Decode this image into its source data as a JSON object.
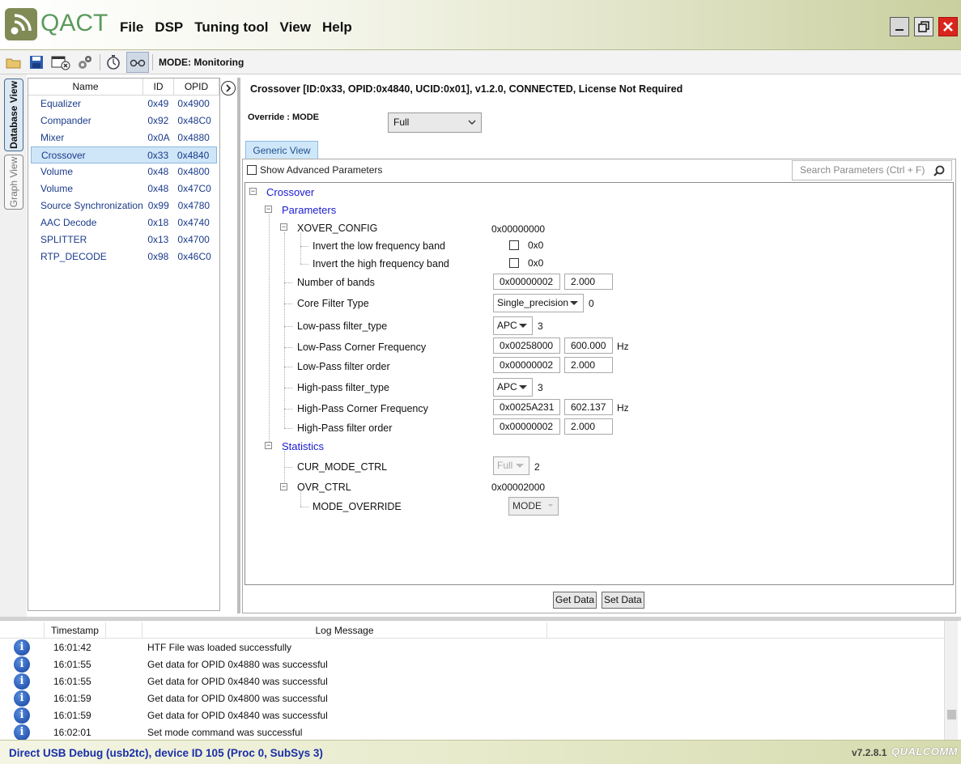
{
  "app": {
    "brand": "QACT"
  },
  "menu": [
    "File",
    "DSP",
    "Tuning tool",
    "View",
    "Help"
  ],
  "toolbar": {
    "mode": "MODE: Monitoring"
  },
  "side_tabs": {
    "database": "Database View",
    "graph": "Graph View"
  },
  "modules": {
    "headers": {
      "name": "Name",
      "id": "ID",
      "opid": "OPID"
    },
    "rows": [
      {
        "name": "Equalizer",
        "id": "0x49",
        "opid": "0x4900"
      },
      {
        "name": "Compander",
        "id": "0x92",
        "opid": "0x48C0"
      },
      {
        "name": "Mixer",
        "id": "0x0A",
        "opid": "0x4880"
      },
      {
        "name": "Crossover",
        "id": "0x33",
        "opid": "0x4840"
      },
      {
        "name": "Volume",
        "id": "0x48",
        "opid": "0x4800"
      },
      {
        "name": "Volume",
        "id": "0x48",
        "opid": "0x47C0"
      },
      {
        "name": "Source Synchronization",
        "id": "0x99",
        "opid": "0x4780"
      },
      {
        "name": "AAC Decode",
        "id": "0x18",
        "opid": "0x4740"
      },
      {
        "name": "SPLITTER",
        "id": "0x13",
        "opid": "0x4700"
      },
      {
        "name": "RTP_DECODE",
        "id": "0x98",
        "opid": "0x46C0"
      }
    ]
  },
  "detail": {
    "header": "Crossover [ID:0x33, OPID:0x4840, UCID:0x01], v1.2.0,  CONNECTED, License Not Required",
    "override_label": "Override : MODE",
    "override_value": "Full",
    "tab": "Generic View",
    "advanced_label": "Show Advanced Parameters",
    "search_placeholder": "Search Parameters (Ctrl + F)"
  },
  "tree": {
    "root": "Crossover",
    "parameters": "Parameters",
    "xover_config": {
      "label": "XOVER_CONFIG",
      "value": "0x00000000"
    },
    "invert_low": {
      "label": "Invert the low frequency band",
      "value": "0x0"
    },
    "invert_high": {
      "label": "Invert the high frequency band",
      "value": "0x0"
    },
    "num_bands": {
      "label": "Number of bands",
      "hex": "0x00000002",
      "val": "2.000"
    },
    "core_filter": {
      "label": "Core Filter Type",
      "select": "Single_precision",
      "raw": "0"
    },
    "lp_type": {
      "label": "Low-pass filter_type",
      "select": "APC",
      "raw": "3"
    },
    "lp_freq": {
      "label": "Low-Pass Corner Frequency",
      "hex": "0x00258000",
      "val": "600.000",
      "unit": "Hz"
    },
    "lp_order": {
      "label": "Low-Pass filter order",
      "hex": "0x00000002",
      "val": "2.000"
    },
    "hp_type": {
      "label": "High-pass filter_type",
      "select": "APC",
      "raw": "3"
    },
    "hp_freq": {
      "label": "High-Pass Corner Frequency",
      "hex": "0x0025A231",
      "val": "602.137",
      "unit": "Hz"
    },
    "hp_order": {
      "label": "High-Pass filter order",
      "hex": "0x00000002",
      "val": "2.000"
    },
    "statistics": "Statistics",
    "cur_mode": {
      "label": "CUR_MODE_CTRL",
      "select": "Full",
      "raw": "2"
    },
    "ovr_ctrl": {
      "label": "OVR_CTRL",
      "value": "0x00002000"
    },
    "mode_override": {
      "label": "MODE_OVERRIDE",
      "select": "MODE"
    }
  },
  "buttons": {
    "get": "Get Data",
    "set": "Set Data"
  },
  "log": {
    "headers": {
      "timestamp": "Timestamp",
      "message": "Log Message"
    },
    "rows": [
      {
        "ts": "16:01:42",
        "msg": "HTF File was loaded successfully"
      },
      {
        "ts": "16:01:55",
        "msg": "Get data for OPID 0x4880 was successful"
      },
      {
        "ts": "16:01:55",
        "msg": "Get data for OPID 0x4840 was successful"
      },
      {
        "ts": "16:01:59",
        "msg": "Get data for OPID 0x4800 was successful"
      },
      {
        "ts": "16:01:59",
        "msg": "Get data for OPID 0x4840 was successful"
      },
      {
        "ts": "16:02:01",
        "msg": "Set mode command was successful"
      }
    ]
  },
  "status": {
    "connection": "Direct USB Debug (usb2tc), device ID 105 (Proc 0, SubSys 3)",
    "version": "v7.2.8.1",
    "vendor": "QUALCOMM"
  }
}
